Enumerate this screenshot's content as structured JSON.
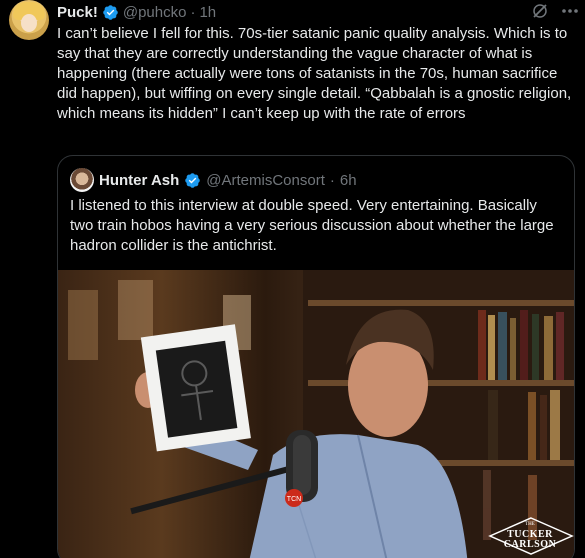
{
  "post": {
    "author_name": "Puck!",
    "author_handle": "@puhcko",
    "separator": "·",
    "timestamp": "1h",
    "text": "I can’t believe I fell for this. 70s-tier satanic panic quality analysis. Which is to say that they are correctly understanding the vague character of what is happening (there actually were tons of satanists in the 70s, human sacrifice did happen), but wiffing on every single detail. “Qabbalah is a gnostic religion, which means its hidden” I can’t keep up with the rate of errors",
    "verified_icon": "verified-badge-icon",
    "grok_icon": "grok-icon",
    "more_icon": "more-options-icon"
  },
  "quoted_post": {
    "author_name": "Hunter Ash",
    "author_handle": "@ArtemisConsort",
    "separator": "·",
    "timestamp": "6h",
    "text": "I listened to this interview at double speed. Very entertaining. Basically two train hobos having a very serious discussion about whether the large hadron collider is the antichrist.",
    "media": {
      "watermark_the": "THE",
      "watermark_line1": "TUCKER",
      "watermark_line2": "CARLSON"
    }
  },
  "colors": {
    "background": "#000000",
    "text_primary": "#e7e9ea",
    "text_secondary": "#71767b",
    "border": "#2f3336",
    "verified_blue": "#1d9bf0"
  }
}
